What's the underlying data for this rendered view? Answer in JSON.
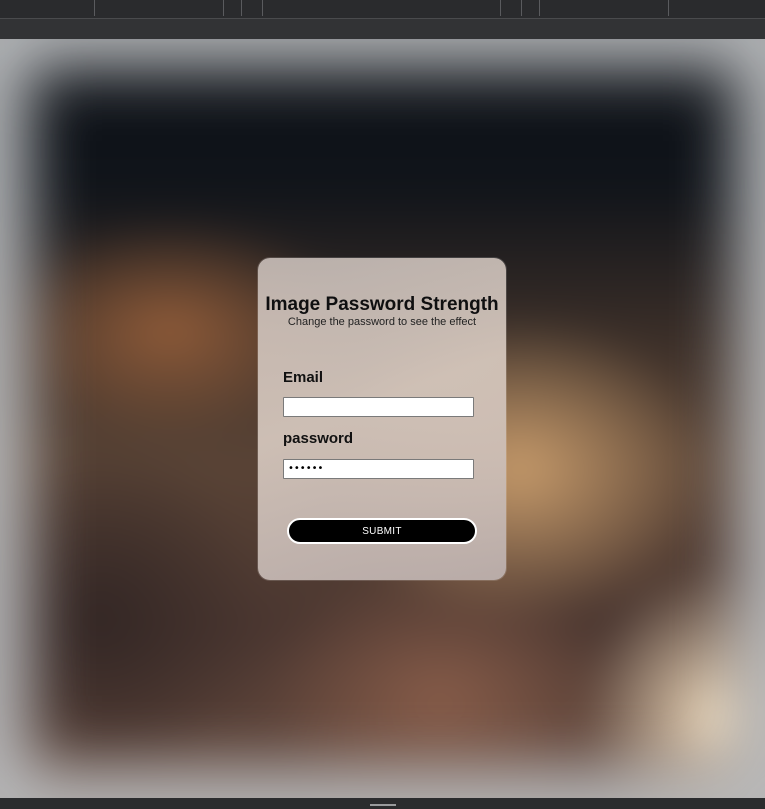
{
  "card": {
    "title": "Image Password Strength",
    "subtitle": "Change the password to see the effect",
    "email_label": "Email",
    "email_value": "",
    "password_label": "password",
    "password_value": "••••••",
    "submit_label": "SUBMIT"
  },
  "colors": {
    "button_bg": "#000000",
    "button_text": "#ffffff",
    "card_bg": "#d2c6c0"
  }
}
